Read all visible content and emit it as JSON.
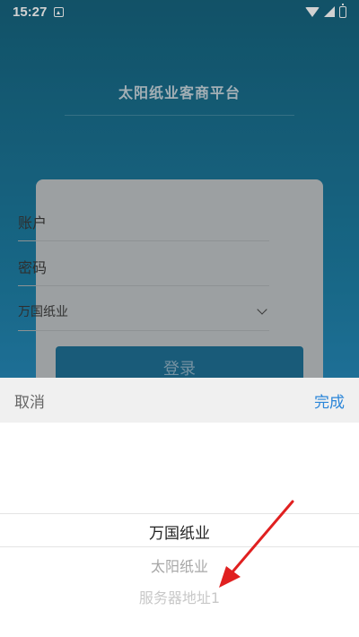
{
  "status_bar": {
    "time": "15:27"
  },
  "app": {
    "title": "太阳纸业客商平台"
  },
  "login": {
    "account_placeholder": "账户",
    "password_placeholder": "密码",
    "company_value": "万国纸业",
    "login_button": "登录"
  },
  "picker": {
    "cancel_label": "取消",
    "done_label": "完成",
    "options": [
      "万国纸业",
      "太阳纸业",
      "服务器地址1"
    ],
    "selected_index": 0
  },
  "colors": {
    "accent": "#2b86d9",
    "arrow": "#e02020"
  }
}
